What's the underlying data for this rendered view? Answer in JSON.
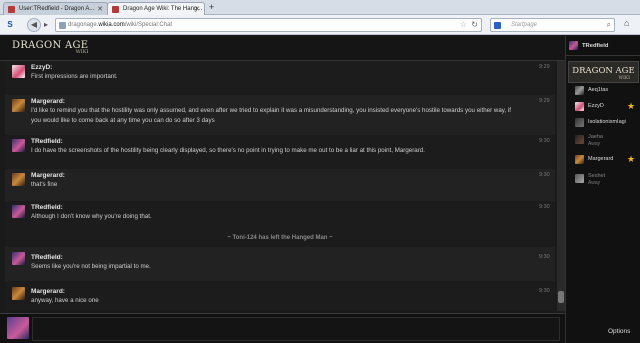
{
  "browser": {
    "tabs": [
      {
        "title": "User:TRedfield - Dragon A...",
        "active": false
      },
      {
        "title": "Dragon Age Wiki: The Hang...",
        "active": true
      }
    ],
    "new_tab": "+",
    "url_prefix": "dragonage.",
    "url_domain": "wikia.com",
    "url_path": "/wiki/Special:Chat",
    "search_placeholder": "Startpage",
    "logo_letter": "S"
  },
  "wiki": {
    "logo_main": "DRAGON AGE",
    "logo_sub": "WIKI"
  },
  "chat": {
    "messages": [
      {
        "user": "EzzyD:",
        "time": "9:29",
        "text": "First impressions are important.",
        "avatar": "ezzy"
      },
      {
        "user": "Margerard:",
        "time": "9:29",
        "text": "I'd like to remind you that the hostility was only assumed, and even after we tried to explain it was a misunderstanding, you insisted everyone's hostile towards you either way, if you would like to come back at any time you can do so after 3 days",
        "avatar": "marg"
      },
      {
        "user": "TRedfield:",
        "time": "9:30",
        "text": "I do have the screenshots of the hostility being clearly displayed, so there's no point in trying to make me out to be a liar at this point, Margerard.",
        "avatar": "tred"
      },
      {
        "user": "Margerard:",
        "time": "9:30",
        "text": "that's fine",
        "avatar": "marg"
      },
      {
        "user": "TRedfield:",
        "time": "9:30",
        "text": "Although I don't know why you're doing that.",
        "avatar": "tred"
      },
      {
        "user": "TRedfield:",
        "time": "9:30",
        "text": "Seems like you're not being impartial to me.",
        "avatar": "tred"
      },
      {
        "user": "Margerard:",
        "time": "9:30",
        "text": "anyway, have a nice one",
        "avatar": "marg"
      }
    ],
    "alert": "~ Toni-124 has left the Hanged Man ~"
  },
  "rail": {
    "me": "TRedfield",
    "room_logo_main": "DRAGON AGE",
    "room_logo_sub": "WIKI",
    "users": [
      {
        "name": "Aeq1tas",
        "status": "",
        "star": false
      },
      {
        "name": "EzzyD",
        "status": "",
        "star": true
      },
      {
        "name": "IsolationismIagi",
        "status": "",
        "star": false
      },
      {
        "name": "Jaeha",
        "status": "Away",
        "star": false
      },
      {
        "name": "Margerard",
        "status": "",
        "star": true
      },
      {
        "name": "Seshet",
        "status": "Away",
        "star": false
      }
    ],
    "options": "Options"
  },
  "colors": {
    "background": "#1a1a1a",
    "star": "#f1b71c",
    "text": "#dddddd"
  }
}
